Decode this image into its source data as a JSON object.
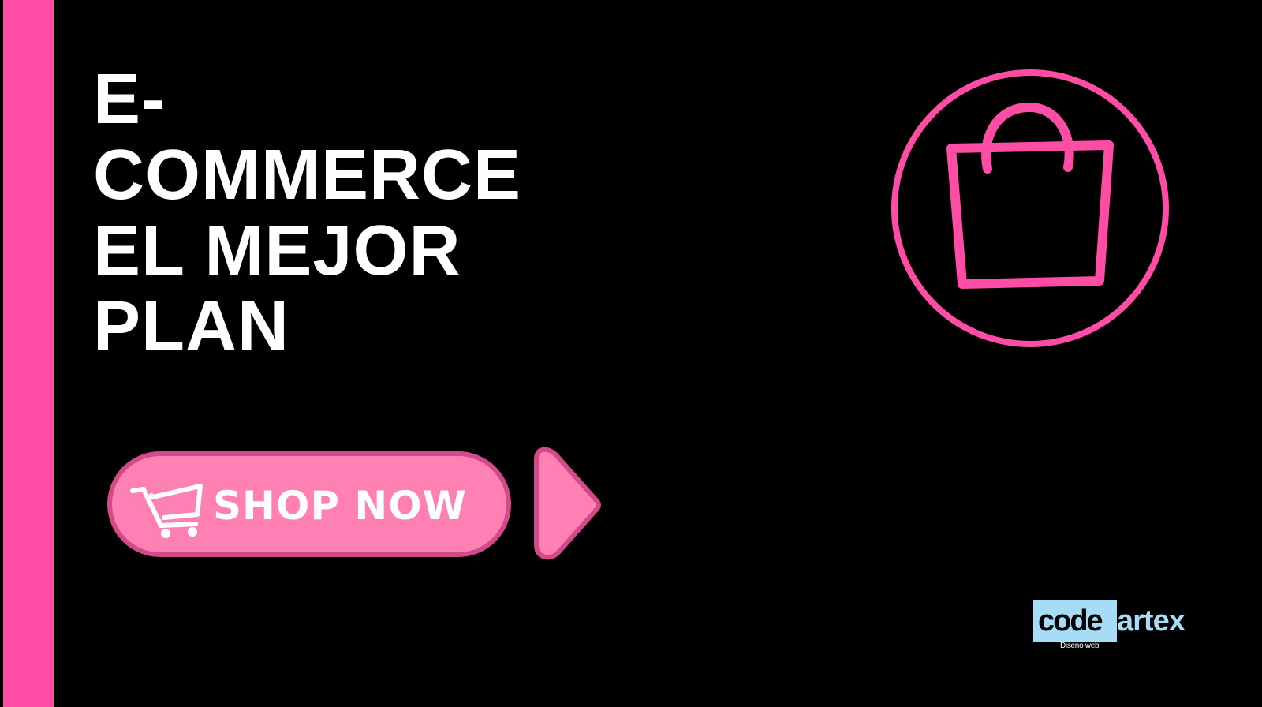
{
  "colors": {
    "background": "#000000",
    "accent_pink": "#ff4da6",
    "button_pink": "#ff80b3",
    "button_border": "#d24a8a",
    "brand_blue": "#a6dcf5",
    "text": "#ffffff"
  },
  "headline": {
    "lines": [
      "E-",
      "COMMERCE",
      "EL MEJOR",
      "PLAN"
    ]
  },
  "icons": {
    "hero": "shopping-bag-icon",
    "cart": "shopping-cart-icon",
    "arrow": "arrow-right-icon"
  },
  "cta": {
    "label": "SHOP NOW"
  },
  "brand": {
    "part1": "code",
    "part2": "artex",
    "tagline": "Diseno web"
  }
}
